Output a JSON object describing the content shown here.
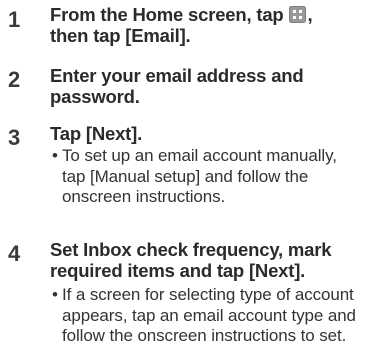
{
  "steps": [
    {
      "number": "1",
      "title_lines": [
        "From the Home screen, tap",
        "then tap [Email]."
      ],
      "title_tail": ","
    },
    {
      "number": "2",
      "title_lines": [
        "Enter your email address and",
        "password."
      ]
    },
    {
      "number": "3",
      "title_lines": [
        "Tap [Next]."
      ],
      "note_lines": [
        "To set up an email account manually,",
        "tap [Manual setup] and follow the",
        "onscreen instructions."
      ]
    },
    {
      "number": "4",
      "title_lines": [
        "Set Inbox check frequency, mark",
        "required items and tap [Next]."
      ],
      "note_lines": [
        "If a screen for selecting type of account",
        "appears, tap an email account type and",
        "follow the onscreen instructions to set."
      ]
    }
  ],
  "bullet": "•",
  "icons": {
    "apps": "apps-grid-icon"
  }
}
